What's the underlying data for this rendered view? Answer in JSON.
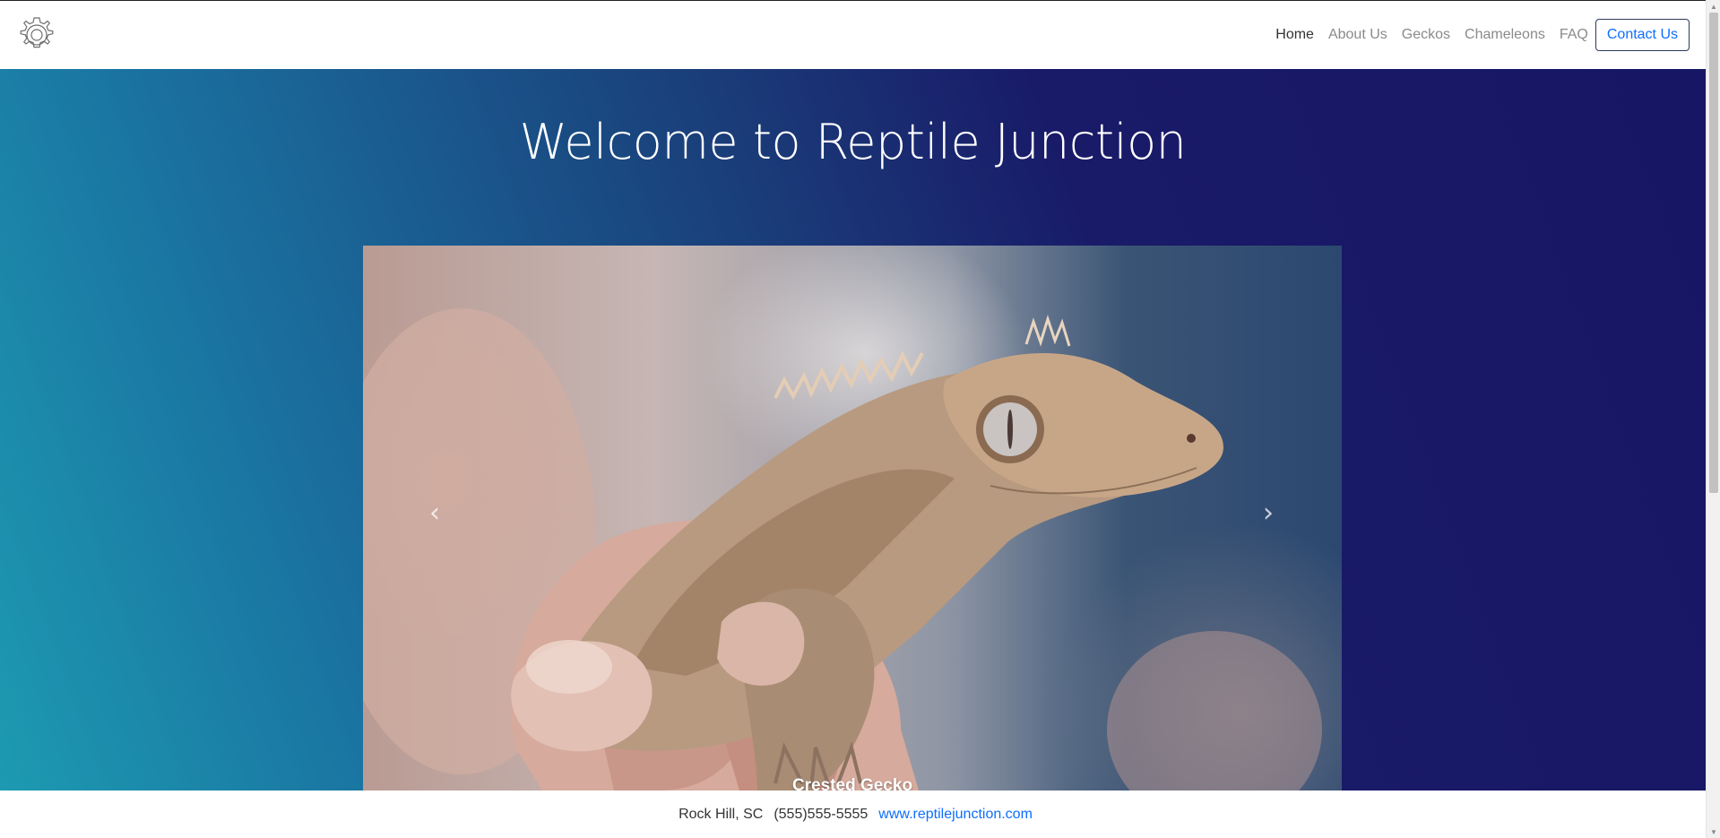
{
  "nav": {
    "logo_icon": "gear-logo-icon",
    "links": [
      {
        "label": "Home",
        "active": true
      },
      {
        "label": "About Us",
        "active": false
      },
      {
        "label": "Geckos",
        "active": false
      },
      {
        "label": "Chameleons",
        "active": false
      },
      {
        "label": "FAQ",
        "active": false
      }
    ],
    "contact_button": "Contact Us"
  },
  "hero": {
    "title": "Welcome to Reptile Junction"
  },
  "carousel": {
    "caption": "Crested Gecko",
    "prev_icon": "chevron-left-icon",
    "next_icon": "chevron-right-icon",
    "prev_glyph": "‹",
    "next_glyph": "›"
  },
  "footer": {
    "location": "Rock Hill, SC",
    "phone": "(555)555-5555",
    "website": "www.reptilejunction.com"
  },
  "colors": {
    "accent_blue": "#0d6efd",
    "hero_gradient_start": "#1d9ab2",
    "hero_gradient_end": "#171664"
  }
}
